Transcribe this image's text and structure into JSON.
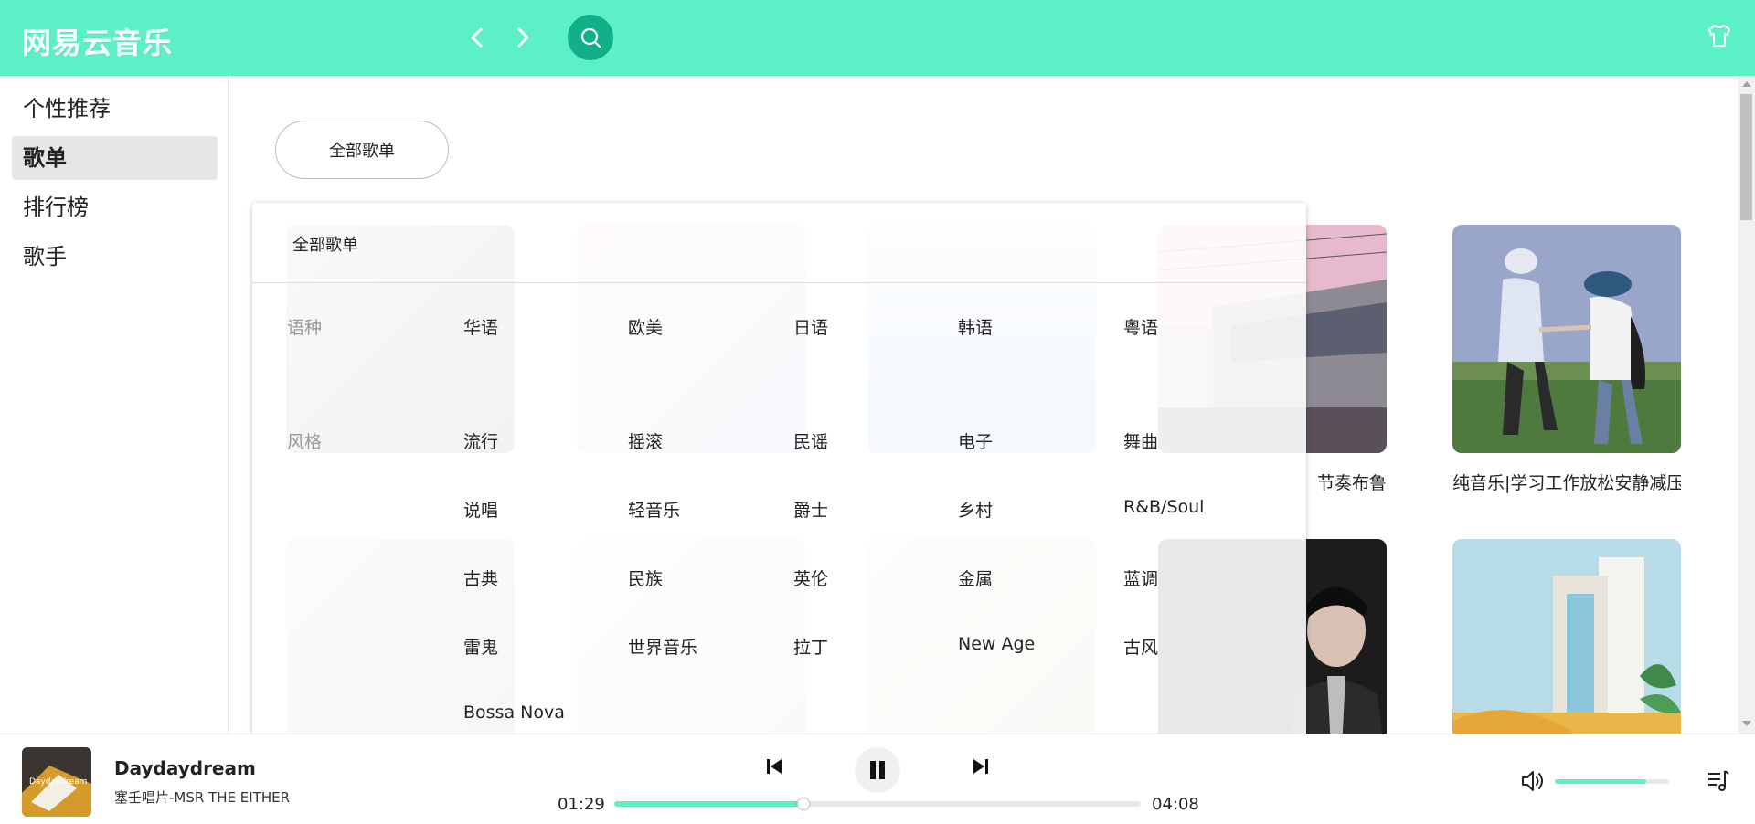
{
  "app": {
    "logo_text": "网易云音乐"
  },
  "colors": {
    "accent": "#5cf0c6",
    "search_bg": "#12b089"
  },
  "sidebar": {
    "items": [
      {
        "label": "个性推荐",
        "active": false
      },
      {
        "label": "歌单",
        "active": true
      },
      {
        "label": "排行榜",
        "active": false
      },
      {
        "label": "歌手",
        "active": false
      }
    ]
  },
  "main": {
    "all_playlists_button": "全部歌单",
    "cards": [
      {
        "title": "节奏布鲁"
      },
      {
        "title": "纯音乐|学习工作放松安静减压"
      }
    ]
  },
  "popup": {
    "title": "全部歌单",
    "categories": [
      {
        "label": "语种",
        "tags": [
          "华语",
          "欧美",
          "日语",
          "韩语",
          "粤语"
        ]
      },
      {
        "label": "风格",
        "tags": [
          "流行",
          "摇滚",
          "民谣",
          "电子",
          "舞曲",
          "说唱",
          "轻音乐",
          "爵士",
          "乡村",
          "R&B/Soul",
          "古典",
          "民族",
          "英伦",
          "金属",
          "蓝调",
          "雷鬼",
          "世界音乐",
          "拉丁",
          "New Age",
          "古风",
          "Bossa Nova"
        ]
      }
    ]
  },
  "player": {
    "song_title": "Daydaydream",
    "artist": "塞壬唱片-MSR THE EITHER",
    "current_time": "01:29",
    "total_time": "04:08",
    "progress": 0.36,
    "volume": 0.8
  }
}
